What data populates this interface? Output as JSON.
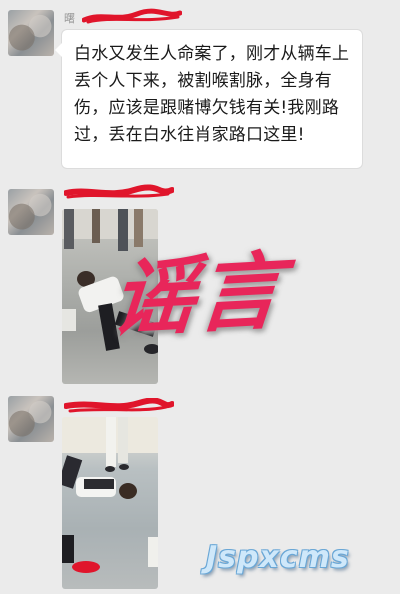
{
  "messages": [
    {
      "sender_fragment": "曙",
      "text": "白水又发生人命案了，刚才从辆车上丢个人下来，被割喉割脉，全身有伤，应该是跟赌博欠钱有关!我刚路过，丢在白水往肖家路口这里!"
    },
    {
      "type": "image"
    },
    {
      "type": "image"
    }
  ],
  "overlay": {
    "stamp_text": "谣言",
    "watermark_text": "Jspxcms"
  },
  "colors": {
    "stamp": "#e8265a",
    "redaction": "#e0152b",
    "watermark": "#cfe8fa"
  }
}
